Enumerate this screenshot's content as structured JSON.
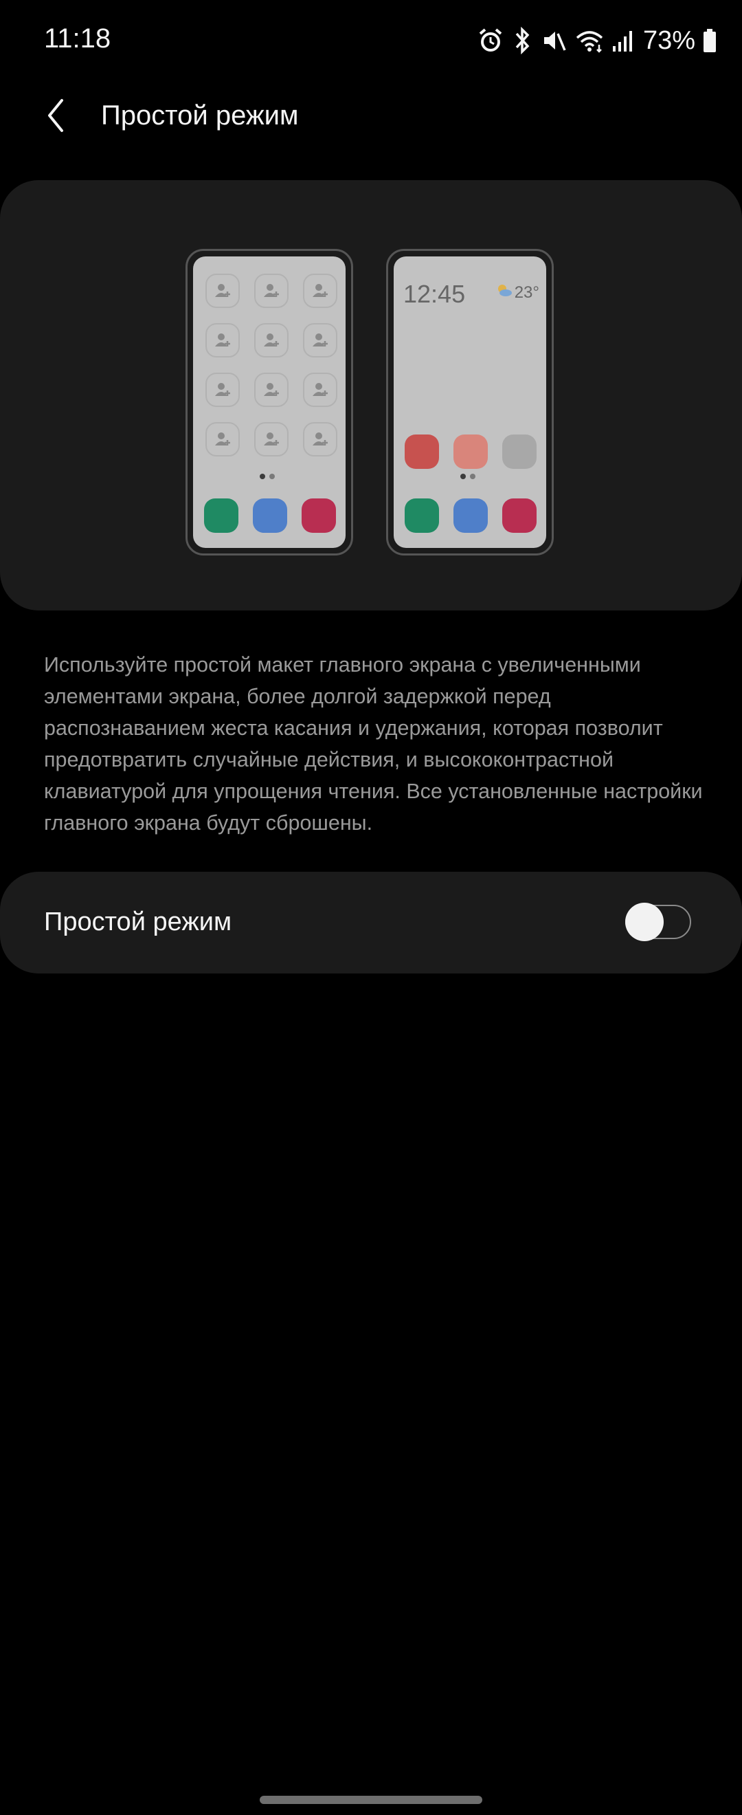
{
  "status_bar": {
    "time": "11:18",
    "battery_percent": "73%",
    "icons": [
      "alarm-icon",
      "bluetooth-icon",
      "mute-icon",
      "wifi-icon",
      "signal-icon",
      "battery-icon"
    ]
  },
  "header": {
    "back_icon": "chevron-left-icon",
    "title": "Простой режим"
  },
  "preview": {
    "right_phone": {
      "clock": "12:45",
      "temperature": "23°"
    },
    "colors": {
      "green": "#1f8a63",
      "blue": "#4f7fc9",
      "crimson": "#b82e51",
      "red": "#c7524f",
      "salmon": "#d9857b",
      "gray": "#a8a8a8"
    }
  },
  "description": "Используйте простой макет главного экрана с увеличенными элементами экрана, более долгой задержкой перед распознаванием жеста касания и удержания, которая позволит предотвратить случайные действия, и высококонтрастной клавиатурой для упрощения чтения. Все установленные настройки главного экрана будут сброшены.",
  "setting": {
    "label": "Простой режим",
    "enabled": false
  }
}
